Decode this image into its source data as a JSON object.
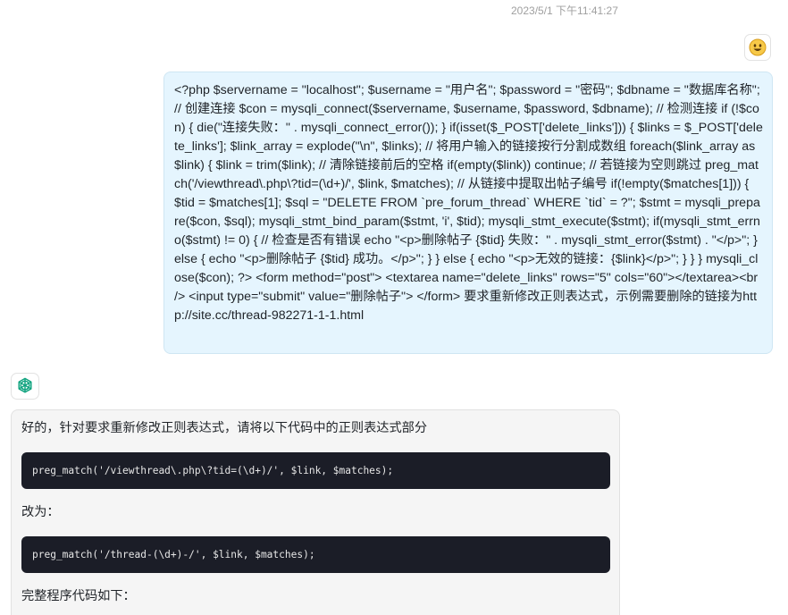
{
  "conversation": {
    "timestamp": "2023/5/1 下午11:41:27",
    "user_message": "<?php $servername = \"localhost\"; $username = \"用户名\"; $password = \"密码\"; $dbname = \"数据库名称\"; // 创建连接 $con = mysqli_connect($servername, $username, $password, $dbname); // 检测连接 if (!$con) { die(\"连接失败：\" . mysqli_connect_error()); } if(isset($_POST['delete_links'])) { $links = $_POST['delete_links']; $link_array = explode(\"\\n\", $links); // 将用户输入的链接按行分割成数组 foreach($link_array as $link) { $link = trim($link); // 清除链接前后的空格 if(empty($link)) continue; // 若链接为空则跳过 preg_match('/viewthread\\.php\\?tid=(\\d+)/', $link, $matches); // 从链接中提取出帖子编号 if(!empty($matches[1])) { $tid = $matches[1]; $sql = \"DELETE FROM `pre_forum_thread` WHERE `tid` = ?\"; $stmt = mysqli_prepare($con, $sql); mysqli_stmt_bind_param($stmt, 'i', $tid); mysqli_stmt_execute($stmt); if(mysqli_stmt_errno($stmt) != 0) { // 检查是否有错误 echo \"<p>删除帖子 {$tid} 失败：\" . mysqli_stmt_error($stmt) . \"</p>\"; } else { echo \"<p>删除帖子 {$tid} 成功。</p>\"; } } else { echo \"<p>无效的链接：{$link}</p>\"; } } } mysqli_close($con); ?> <form method=\"post\"> <textarea name=\"delete_links\" rows=\"5\" cols=\"60\"></textarea><br /> <input type=\"submit\" value=\"删除帖子\"> </form> 要求重新修改正则表达式，示例需要删除的链接为http://site.cc/thread-982271-1-1.html",
    "user_avatar_icon": "smiley-face-icon",
    "bot_avatar_icon": "openai-logo-icon",
    "bot": {
      "intro": "好的，针对要求重新修改正则表达式，请将以下代码中的正则表达式部分",
      "code_old": "preg_match('/viewthread\\.php\\?tid=(\\d+)/', $link, $matches);",
      "change_to": "改为：",
      "code_new": "preg_match('/thread-(\\d+)-/', $link, $matches);",
      "full_code_label": "完整程序代码如下："
    }
  },
  "colors": {
    "user_bubble_bg": "#e5f5fe",
    "bot_bubble_bg": "#f5f5f5",
    "code_bg": "#1b1d27",
    "timestamp": "#a0a0a0"
  }
}
